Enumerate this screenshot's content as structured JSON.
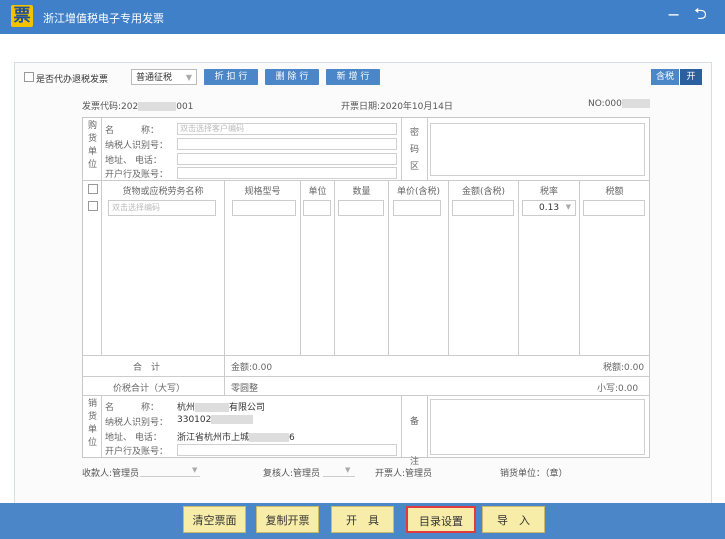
{
  "app": {
    "icon_glyph": "票",
    "title": "浙江增值税电子专用发票",
    "minimize_glyph": "−",
    "back_glyph": "⮌"
  },
  "toolbar": {
    "agent_check_label": "是否代办退税发票",
    "levy_select": {
      "value": "普通征税",
      "arrow": "▼"
    },
    "buttons": [
      "折 扣 行",
      "删 除 行",
      "新 增 行"
    ],
    "tax_label": "含税",
    "tax_state": "开"
  },
  "header": {
    "code_label": "发票代码:202",
    "code_tail": "001",
    "date": "开票日期:2020年10月14日",
    "no_label": "NO:000"
  },
  "buyer": {
    "side_chars": [
      "购",
      "货",
      "单",
      "位"
    ],
    "labels": [
      "名　　　称：",
      "纳税人识别号：",
      "地址、  电话：",
      "开户行及账号："
    ],
    "name_placeholder": "双击选择客户编码",
    "secret_chars": [
      "密",
      "码",
      "区"
    ]
  },
  "items": {
    "headers": [
      "货物或应税劳务名称",
      "规格型号",
      "单位",
      "数量",
      "单价(含税)",
      "金额(含税)",
      "税率",
      "税额"
    ],
    "name_placeholder": "双击选择编码",
    "tax_rate": "0.13",
    "tax_rate_arrow": "▼"
  },
  "totals": {
    "total_label": "合　计",
    "amount": "金额:0.00",
    "tax": "税额:0.00",
    "price_tax_label": "价税合计（大写）",
    "upper": "零圆整",
    "lower": "小写:0.00"
  },
  "seller": {
    "side_chars": [
      "销",
      "货",
      "单",
      "位"
    ],
    "labels": [
      "名　　　称：",
      "纳税人识别号：",
      "地址、  电话：",
      "开户行及账号："
    ],
    "name_prefix": "杭州",
    "name_suffix": "有限公司",
    "tax_id_prefix": "330102",
    "address_prefix": "浙江省杭州市上城",
    "address_suffix": "6",
    "remark_chars": [
      "备",
      "注"
    ]
  },
  "signatures": {
    "payee": "收款人:管理员",
    "reviewer": "复核人:管理员",
    "issuer": "开票人:管理员",
    "seller_unit": "销货单位：（章）",
    "arrow": "▼"
  },
  "actions": [
    "清空票面",
    "复制开票",
    "开　具",
    "目录设置",
    "导　入"
  ],
  "colors": {
    "title_bar": "#3f80c8",
    "action_button": "#f7eca8",
    "highlight_border": "#e0393e"
  }
}
